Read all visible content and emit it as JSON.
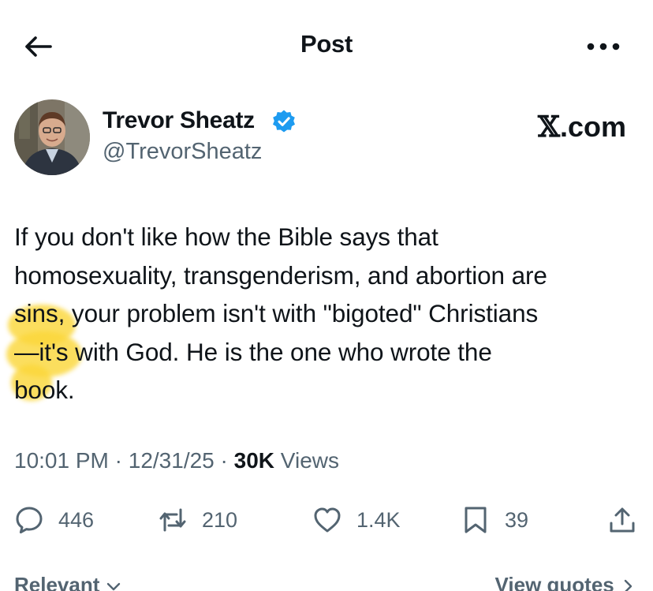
{
  "header": {
    "title": "Post"
  },
  "author": {
    "name": "Trevor Sheatz",
    "handle": "@TrevorSheatz",
    "verified": true
  },
  "brand": {
    "x_glyph": "𝕏",
    "suffix": ".com"
  },
  "tweet": {
    "lines": [
      "If you don't like how the Bible says that",
      "homosexuality, transgenderism, and abortion are",
      "sins, your problem isn't with \"bigoted\" Christians",
      "—it's with God. He is the one who wrote the",
      "book."
    ]
  },
  "meta": {
    "time": "10:01 PM",
    "date": "12/31/25",
    "views_count": "30K",
    "views_label": "Views",
    "separator": "·"
  },
  "actions": {
    "replies": "446",
    "reposts": "210",
    "likes": "1.4K",
    "bookmarks": "39"
  },
  "footer": {
    "sort_label": "Relevant",
    "quotes_label": "View quotes"
  },
  "colors": {
    "text": "#0f1419",
    "secondary": "#536471",
    "verified_blue": "#1d9bf0",
    "highlight": "#fbd73b"
  }
}
